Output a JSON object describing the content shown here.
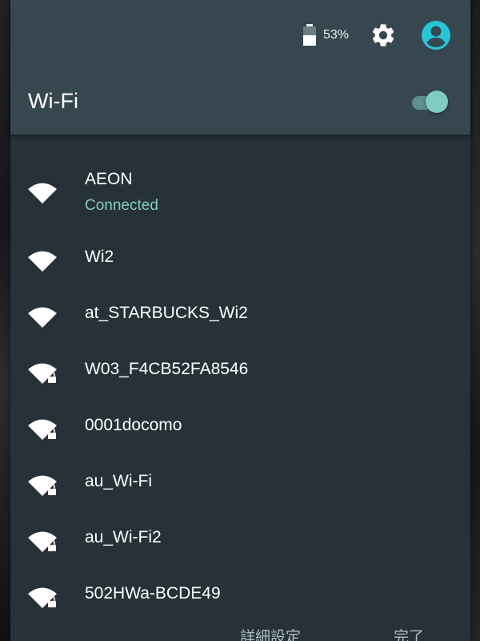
{
  "status_bar": {
    "battery_percent": "53%",
    "battery_level": 0.53,
    "icons": [
      "battery-icon",
      "gear-icon",
      "account-circle-icon"
    ]
  },
  "header": {
    "title": "Wi-Fi",
    "toggle_on": true
  },
  "colors": {
    "header_bg": "#37474f",
    "panel_bg": "#263238",
    "accent": "#80cbc4",
    "avatar": "#26c6da"
  },
  "networks": [
    {
      "name": "AEON",
      "status": "Connected",
      "secured": false
    },
    {
      "name": "Wi2",
      "secured": false
    },
    {
      "name": "at_STARBUCKS_Wi2",
      "secured": false
    },
    {
      "name": "W03_F4CB52FA8546",
      "secured": true
    },
    {
      "name": "0001docomo",
      "secured": true
    },
    {
      "name": "au_Wi-Fi",
      "secured": true
    },
    {
      "name": "au_Wi-Fi2",
      "secured": true
    },
    {
      "name": "502HWa-BCDE49",
      "secured": true
    }
  ],
  "footer": {
    "more_settings_label": "詳細設定",
    "done_label": "完了"
  }
}
